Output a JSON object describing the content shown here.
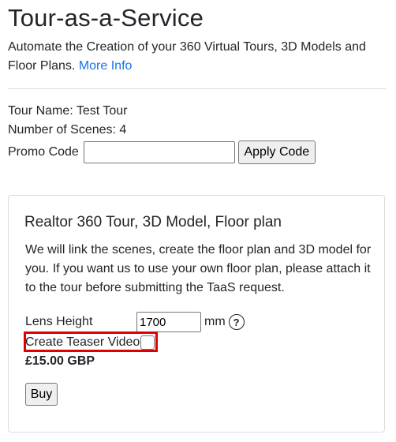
{
  "header": {
    "title": "Tour-as-a-Service",
    "description": "Automate the Creation of your 360 Virtual Tours, 3D Models and Floor Plans.",
    "more_info_link": "More Info"
  },
  "tour": {
    "name_line": "Tour Name: Test Tour",
    "scenes_line": "Number of Scenes: 4"
  },
  "promo": {
    "label": "Promo Code",
    "value": "",
    "placeholder": "",
    "apply_label": "Apply Code"
  },
  "product": {
    "title": "Realtor 360 Tour, 3D Model, Floor plan",
    "description": "We will link the scenes, create the floor plan and 3D model for you. If you want us to use your own floor plan, please attach it to the tour before submitting the TaaS request.",
    "lens_label": "Lens Height",
    "lens_value": "1700",
    "lens_unit": "mm",
    "help_symbol": "?",
    "teaser_label": "Create Teaser Video",
    "teaser_checked": false,
    "price": "£15.00 GBP",
    "buy_label": "Buy"
  },
  "colors": {
    "link": "#1a73e8",
    "highlight": "#e00000"
  },
  "icons": {
    "help": "help-circle-icon"
  }
}
